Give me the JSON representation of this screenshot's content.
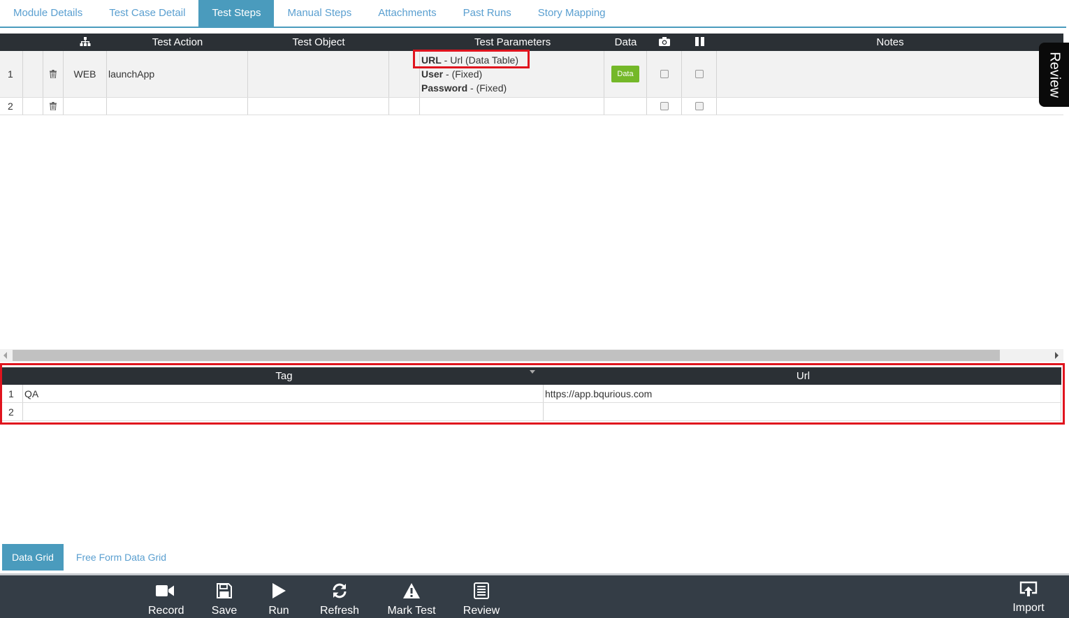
{
  "tabs": [
    "Module Details",
    "Test Case Detail",
    "Test Steps",
    "Manual Steps",
    "Attachments",
    "Past Runs",
    "Story Mapping"
  ],
  "active_tab": "Test Steps",
  "steps_grid": {
    "headers": {
      "action": "Test Action",
      "object": "Test Object",
      "params": "Test Parameters",
      "data": "Data",
      "notes": "Notes"
    },
    "rows": [
      {
        "num": "1",
        "type": "WEB",
        "action": "launchApp",
        "object": "",
        "params": [
          {
            "name": "URL",
            "value": "- Url (Data Table)"
          },
          {
            "name": "User",
            "value": "-  (Fixed)"
          },
          {
            "name": "Password",
            "value": "-  (Fixed)"
          }
        ],
        "data_button": "Data"
      },
      {
        "num": "2",
        "type": "",
        "action": "",
        "object": "",
        "params": [],
        "data_button": ""
      }
    ]
  },
  "review_tab": "Review",
  "data_grid": {
    "headers": {
      "tag": "Tag",
      "url": "Url"
    },
    "rows": [
      {
        "num": "1",
        "tag": "QA",
        "url": "https://app.bqurious.com"
      },
      {
        "num": "2",
        "tag": "",
        "url": ""
      }
    ]
  },
  "bottom_tabs": [
    "Data Grid",
    "Free Form Data Grid"
  ],
  "toolbar": {
    "record": "Record",
    "save": "Save",
    "run": "Run",
    "refresh": "Refresh",
    "mark_test": "Mark Test",
    "review": "Review",
    "import": "Import"
  },
  "colors": {
    "accent": "#4a9bbd",
    "header_bg": "#2b3035",
    "toolbar_bg": "#343d46",
    "highlight": "#e0141e",
    "data_button": "#74b829"
  }
}
